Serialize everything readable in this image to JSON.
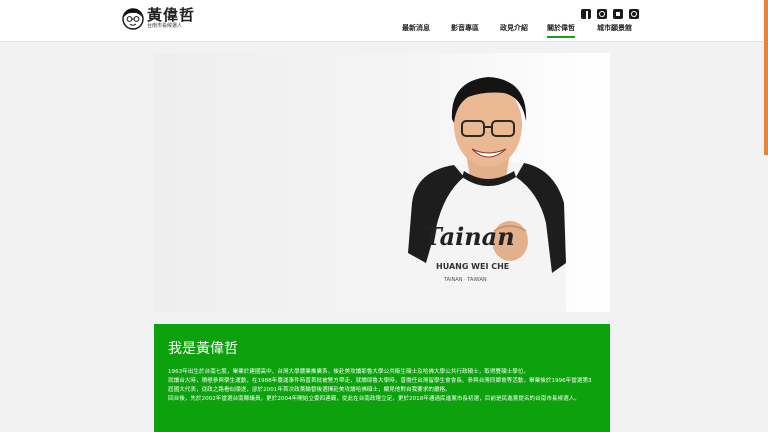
{
  "header": {
    "logo_name": "黃偉哲",
    "logo_subtitle": "台南市長候選人",
    "social_icons": [
      "facebook-icon",
      "instagram-icon",
      "youtube-icon",
      "line-icon"
    ],
    "nav": [
      {
        "label": "最新消息",
        "active": false
      },
      {
        "label": "影音專區",
        "active": false
      },
      {
        "label": "政見介紹",
        "active": false
      },
      {
        "label": "關於偉哲",
        "active": true
      },
      {
        "label": "城市願景館",
        "active": false
      }
    ],
    "accent": "#1e9c1e"
  },
  "hero": {
    "shirt_text_1": "Tainan",
    "shirt_text_2": "HUANG WEI CHE",
    "shirt_text_3": "TAINAN · TAIWAN"
  },
  "intro": {
    "title": "我是黃偉哲",
    "paragraphs": [
      "1963年出生於台南七股，畢業於建國高中、台灣大學農業推廣系，後赴美攻讀耶魯大學公共衛生碩士及哈佛大學公共行政碩士，取得雙碩士學位。",
      "就讀台大時，積極參與學生運動，在1988年農運事件時曾首批被警方帶走，就讀耶魯大學時，曾擔任台灣留學生會會長、參與台灣同鄉會等活動，畢業後於1996年當選第3屆國大代表，從政之路看似順遂，卻於2001年首次政黨輪替後選擇赴美攻讀哈佛碩士，顯見他對自我要求的嚴格。",
      "回台後，先於2002年當選台南縣議員，更於2004年開始立委四連霸，從此在台南政壇立足，更於2018年通過民進黨市長初選，目前是民進黨提名的台南市長候選人。"
    ],
    "bg_color": "#0ea10e"
  }
}
